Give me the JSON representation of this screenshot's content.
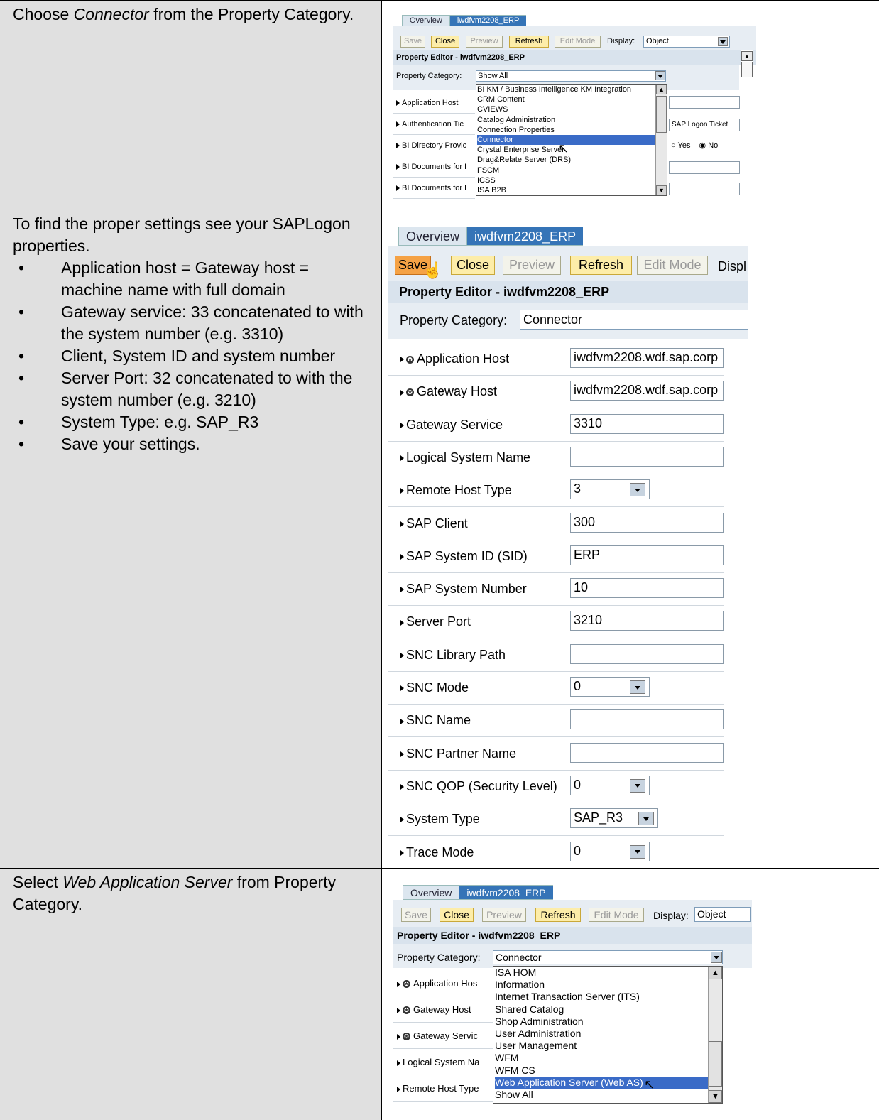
{
  "steps": [
    {
      "instruction_pre": "Choose ",
      "instruction_em": "Connector",
      "instruction_post": " from the Property Category."
    },
    {
      "instruction": "To find the proper settings see your SAPLogon properties.",
      "bullets": [
        "Application host = Gateway host = machine name with full domain",
        "Gateway service: 33 concatenated to with the system number (e.g. 3310)",
        "Client, System ID and system number",
        "Server Port: 32 concatenated to with the system number (e.g. 3210)",
        "System Type: e.g. SAP_R3",
        "Save your settings."
      ]
    },
    {
      "instruction_pre": "Select ",
      "instruction_em": "Web Application Server",
      "instruction_post": " from Property Category."
    }
  ],
  "sap": {
    "tab_overview": "Overview",
    "tab_system": "iwdfvm2208_ERP",
    "btn_save": "Save",
    "btn_close": "Close",
    "btn_preview": "Preview",
    "btn_refresh": "Refresh",
    "btn_editmode": "Edit Mode",
    "display_label": "Display:",
    "display_label_cut": "Displ",
    "display_value": "Object",
    "editor_title": "Property Editor - iwdfvm2208_ERP",
    "category_label": "Property Category:"
  },
  "screen1": {
    "category_value": "Show All",
    "props": [
      "Application Host",
      "Authentication Tic",
      "BI Directory Provic",
      "BI Documents for I",
      "BI Documents for I"
    ],
    "sap_logon_value": "SAP Logon Ticket",
    "radio_yes": "Yes",
    "radio_no": "No",
    "list": [
      "BI KM / Business Intelligence KM Integration",
      "CRM Content",
      "CVIEWS",
      "Catalog Administration",
      "Connection Properties",
      "Connector",
      "Crystal Enterprise Server",
      "Drag&Relate Server (DRS)",
      "FSCM",
      "ICSS",
      "ISA B2B"
    ]
  },
  "screen2": {
    "category_value": "Connector",
    "props": [
      {
        "label": "Application Host",
        "value": "iwdfvm2208.wdf.sap.corp"
      },
      {
        "label": "Gateway Host",
        "value": "iwdfvm2208.wdf.sap.corp"
      },
      {
        "label": "Gateway Service",
        "value": "3310"
      },
      {
        "label": "Logical System Name",
        "value": ""
      },
      {
        "label": "Remote Host Type",
        "value": "3"
      },
      {
        "label": "SAP Client",
        "value": "300"
      },
      {
        "label": "SAP System ID (SID)",
        "value": "ERP"
      },
      {
        "label": "SAP System Number",
        "value": "10"
      },
      {
        "label": "Server Port",
        "value": "3210"
      },
      {
        "label": "SNC Library Path",
        "value": ""
      },
      {
        "label": "SNC Mode",
        "value": "0"
      },
      {
        "label": "SNC Name",
        "value": ""
      },
      {
        "label": "SNC Partner Name",
        "value": ""
      },
      {
        "label": "SNC QOP (Security Level)",
        "value": "0"
      },
      {
        "label": "System Type",
        "value": "SAP_R3"
      },
      {
        "label": "Trace Mode",
        "value": "0"
      }
    ]
  },
  "screen3": {
    "category_value": "Connector",
    "props": [
      "Application Hos",
      "Gateway Host",
      "Gateway Servic",
      "Logical System Na",
      "Remote Host Type"
    ],
    "list": [
      "ISA HOM",
      "Information",
      "Internet Transaction Server (ITS)",
      "Shared Catalog",
      "Shop Administration",
      "User Administration",
      "User Management",
      "WFM",
      "WFM CS",
      "Web Application Server (Web AS)",
      "Show All"
    ]
  }
}
